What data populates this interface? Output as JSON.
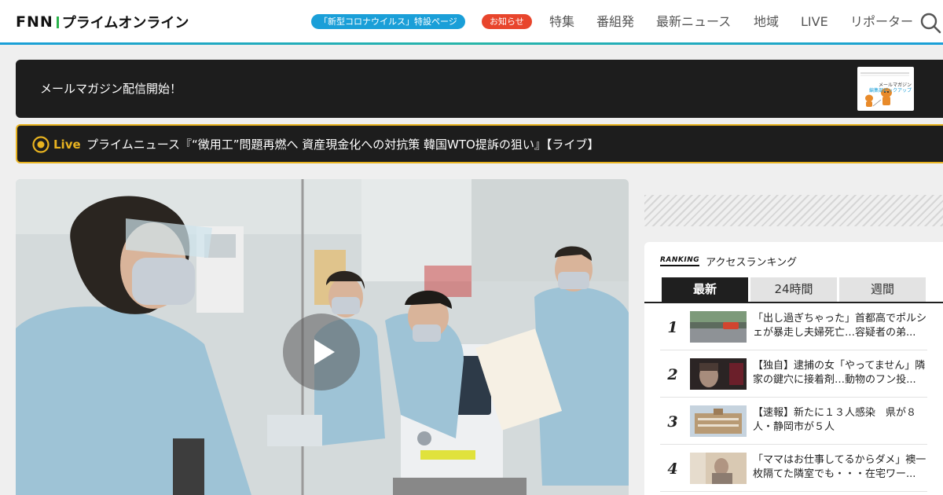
{
  "header": {
    "logo_fnn": "FNN",
    "logo_text": "プライムオンライン",
    "corona_pill": "「新型コロナウイルス」特設ページ",
    "notice_pill": "お知らせ",
    "nav": [
      "特集",
      "番組発",
      "最新ニュース",
      "地域",
      "LIVE",
      "リポーター"
    ],
    "accent_color": "#1a9fd8",
    "notice_color": "#e8452c"
  },
  "newsletter": {
    "text": "メールマガジン配信開始！",
    "thumb_title": "メールマガジン",
    "thumb_sub": "編集部ピックアップ"
  },
  "live": {
    "label": "Live",
    "title": "プライムニュース『“徴用工”問題再燃へ 資産現金化への対抗策 韓国WTO提訴の狙い』【ライブ】",
    "color": "#e8b320"
  },
  "ranking": {
    "badge": "RANKING",
    "title": "アクセスランキング",
    "tabs": [
      "最新",
      "24時間",
      "週間"
    ],
    "items": [
      {
        "rank": "1",
        "text": "「出し過ぎちゃった」首都高でポルシェが暴走し夫婦死亡…容疑者の弟..."
      },
      {
        "rank": "2",
        "text": "【独自】逮捕の女「やってません」隣家の鍵穴に接着剤…動物のフン投..."
      },
      {
        "rank": "3",
        "text": "【速報】新たに１３人感染　県が８人・静岡市が５人"
      },
      {
        "rank": "4",
        "text": "「ママはお仕事してるからダメ」襖一枚隔てた隣室でも・・・在宅ワー..."
      }
    ]
  }
}
